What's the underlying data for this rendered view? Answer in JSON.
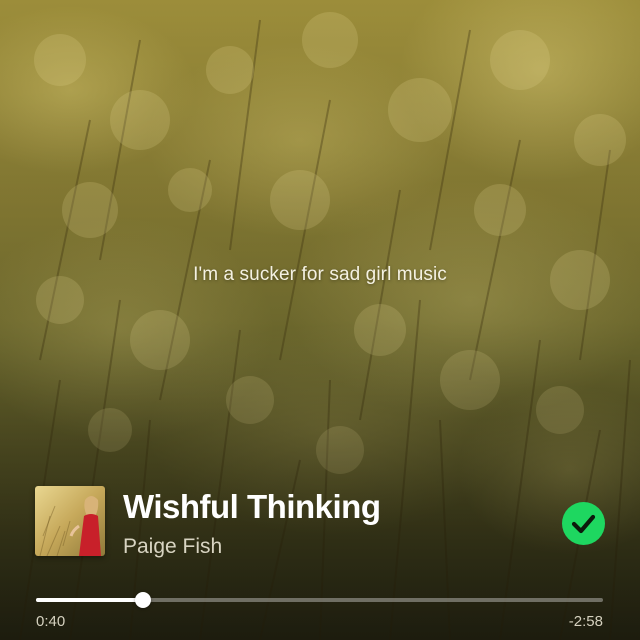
{
  "lyrics": {
    "current_line": "I'm a sucker for sad girl music"
  },
  "now_playing": {
    "title": "Wishful Thinking",
    "artist": "Paige Fish",
    "album_art_icon": "album-cover",
    "saved": true,
    "saved_icon": "checkmark-icon",
    "saved_color": "#1ed760"
  },
  "playback": {
    "elapsed": "0:40",
    "remaining": "-2:58",
    "progress_fraction": 0.1887
  }
}
